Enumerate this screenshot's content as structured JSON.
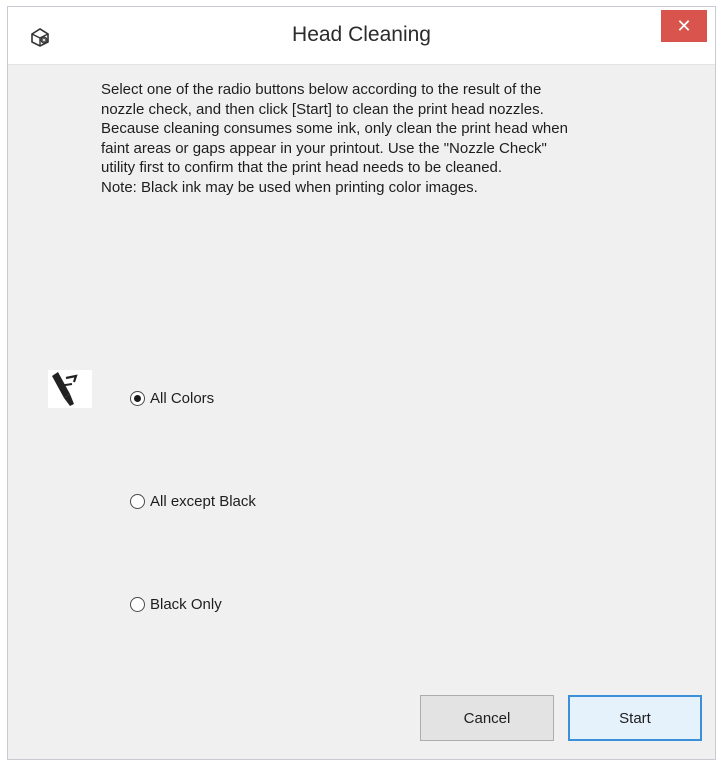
{
  "window": {
    "title": "Head Cleaning",
    "close_label": "✕"
  },
  "instructions": {
    "text": "Select one of the radio buttons below according to the result of the\nnozzle check, and then click [Start] to clean the print head nozzles.\nBecause cleaning consumes some ink, only clean the print head when\nfaint areas or gaps appear in your printout. Use the \"Nozzle Check\"\nutility first to confirm that the print head needs to be cleaned.\nNote: Black ink may be used when printing color images."
  },
  "options": [
    {
      "label": "All Colors",
      "selected": true
    },
    {
      "label": "All except Black",
      "selected": false
    },
    {
      "label": "Black Only",
      "selected": false
    }
  ],
  "buttons": {
    "cancel_label": "Cancel",
    "start_label": "Start"
  },
  "icons": {
    "app": "printer-settings-icon",
    "nozzle": "print-head-nozzle-icon",
    "close": "close-icon"
  },
  "colors": {
    "close_bg": "#d9544d",
    "default_button_border": "#3c8fd9",
    "dialog_bg": "#f0f0f0"
  }
}
